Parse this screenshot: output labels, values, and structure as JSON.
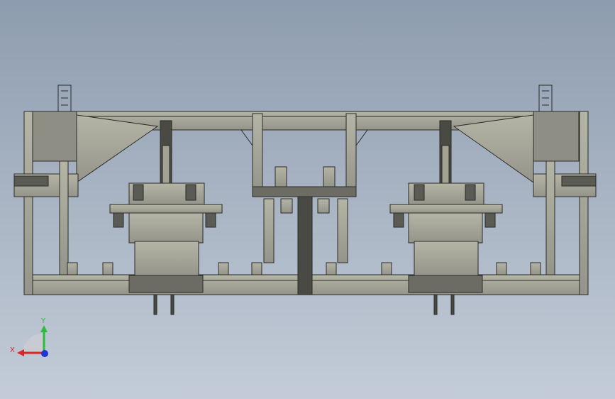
{
  "viewport": {
    "background_top": "#8e9caf",
    "background_bottom": "#c3ccd8",
    "part_color": "#a3a393",
    "part_dark": "#4a4a44",
    "edge_color": "#2b2b28"
  },
  "triad": {
    "x_label": "X",
    "y_label": "Y",
    "x_color": "#d9262b",
    "y_color": "#2bbd3a",
    "z_color": "#1f35d8"
  }
}
